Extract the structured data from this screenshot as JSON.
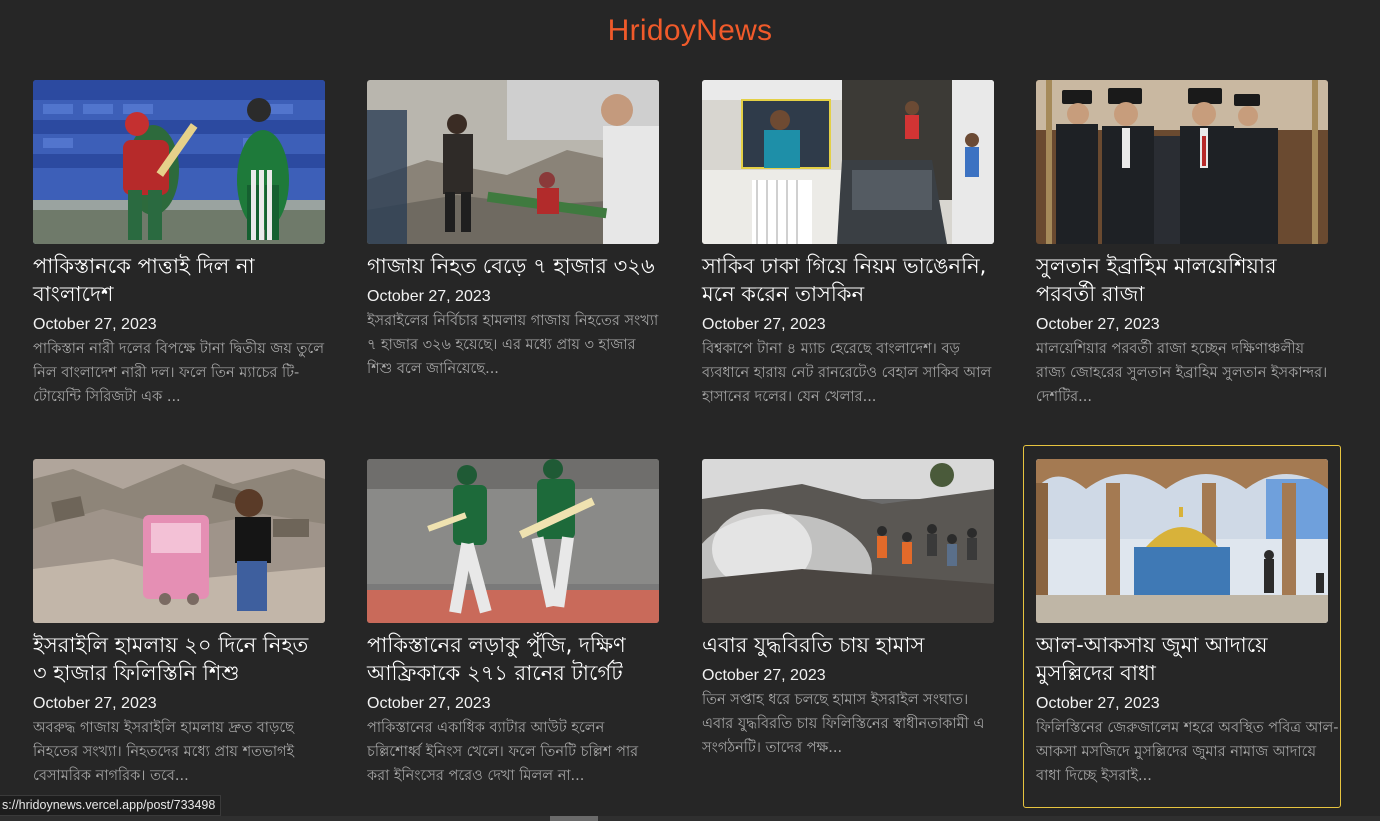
{
  "site": {
    "title": "HridoyNews"
  },
  "cards": [
    {
      "title": "পাকিস্তানকে পাত্তাই দিল না বাংলাদেশ",
      "date": "October 27, 2023",
      "excerpt": "পাকিস্তান নারী দলের বিপক্ষে টানা দ্বিতীয় জয় তুলে নিল বাংলাদেশ নারী দল। ফলে তিন ম্যাচের টি-টোয়েন্টি সিরিজটা এক ..."
    },
    {
      "title": "গাজায় নিহত বেড়ে ৭ হাজার ৩২৬",
      "date": "October 27, 2023",
      "excerpt": "ইসরাইলের নির্বিচার হামলায় গাজায় নিহতের সংখ্যা ৭ হাজার ৩২৬ হয়েছে। এর মধ্যে প্রায় ৩ হাজার শিশু বলে জানিয়েছে..."
    },
    {
      "title": "সাকিব ঢাকা গিয়ে নিয়ম ভাঙেননি, মনে করেন তাসকিন",
      "date": "October 27, 2023",
      "excerpt": "বিশ্বকাপে টানা ৪ ম্যাচ হেরেছে বাংলাদেশ। বড় ব্যবধানে হারায় নেট রানরেটেও বেহাল সাকিব আল হাসানের দলের। যেন খেলার..."
    },
    {
      "title": "সুলতান ইব্রাহিম মালয়েশিয়ার পরবর্তী রাজা",
      "date": "October 27, 2023",
      "excerpt": "মালয়েশিয়ার পরবর্তী রাজা হচ্ছেন দক্ষিণাঞ্চলীয় রাজ্য জোহরের সুলতান ইব্রাহিম সুলতান ইসকান্দর। দেশটির..."
    },
    {
      "title": "ইসরাইলি হামলায় ২০ দিনে নিহত ৩ হাজার ফিলিস্তিনি শিশু",
      "date": "October 27, 2023",
      "excerpt": "অবরুদ্ধ গাজায় ইসরাইলি হামলায় দ্রুত বাড়ছে নিহতের সংখ্যা। নিহতদের মধ্যে প্রায় শতভাগই বেসামরিক নাগরিক। তবে..."
    },
    {
      "title": "পাকিস্তানের লড়াকু পুঁজি, দক্ষিণ আফ্রিকাকে ২৭১ রানের টার্গেট",
      "date": "October 27, 2023",
      "excerpt": "পাকিস্তানের একাধিক ব্যাটার আউট হলেন চল্লিশোর্ধ্ব ইনিংস খেলে। ফলে তিনটি চল্লিশ পার করা ইনিংসের পরেও দেখা মিলল না..."
    },
    {
      "title": "এবার যুদ্ধবিরতি চায় হামাস",
      "date": "October 27, 2023",
      "excerpt": "তিন সপ্তাহ ধরে চলছে হামাস ইসরাইল সংঘাত। এবার যুদ্ধবিরতি চায় ফিলিস্তিনের স্বাধীনতাকামী এ সংগঠনটি। তাদের পক্ষ..."
    },
    {
      "title": "আল-আকসায় জুমা আদায়ে মুসল্লিদের বাধা",
      "date": "October 27, 2023",
      "excerpt": "ফিলিস্তিনের জেরুজালেম শহরে অবস্থিত পবিত্র আল-আকসা মসজিদে মুসল্লিদের জুমার নামাজ আদায়ে বাধা দিচ্ছে ইসরাই..."
    }
  ],
  "status_bar": {
    "url": "s://hridoynews.vercel.app/post/733498"
  },
  "colors": {
    "background": "#262626",
    "brand": "#f05a2a",
    "highlight_border": "#e7c43f"
  }
}
